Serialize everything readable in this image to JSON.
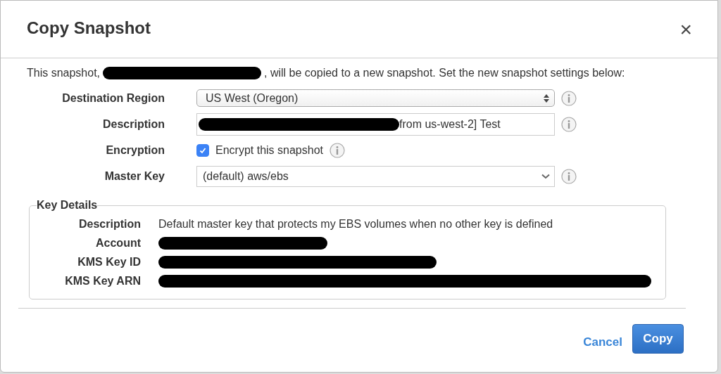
{
  "dialog": {
    "title": "Copy Snapshot",
    "close": "×"
  },
  "intro": {
    "before": "This snapshot,",
    "redacted": true,
    "after": ", will be copied to a new snapshot. Set the new snapshot settings below:"
  },
  "fields": [
    {
      "kind": "select",
      "label": "Destination Region",
      "value": "US West (Oregon)"
    },
    {
      "kind": "text",
      "label": "Description",
      "redacted": true,
      "value": "from us-west-2] Test"
    },
    {
      "kind": "checkbox",
      "label": "Encryption",
      "checked": true,
      "value": "Encrypt this snapshot"
    },
    {
      "kind": "dropdown",
      "label": "Master Key",
      "value": "(default) aws/ebs"
    }
  ],
  "key_details": {
    "legend": "Key Details",
    "rows": [
      {
        "kind": "text",
        "label": "Description",
        "value": "Default master key that protects my EBS volumes when no other key is defined"
      },
      {
        "kind": "redacted",
        "label": "Account"
      },
      {
        "kind": "redacted",
        "label": "KMS Key ID"
      },
      {
        "kind": "redacted",
        "label": "KMS Key ARN"
      }
    ]
  },
  "buttons": [
    {
      "kind": "link",
      "label": "Cancel"
    },
    {
      "kind": "primary",
      "label": "Copy"
    }
  ]
}
